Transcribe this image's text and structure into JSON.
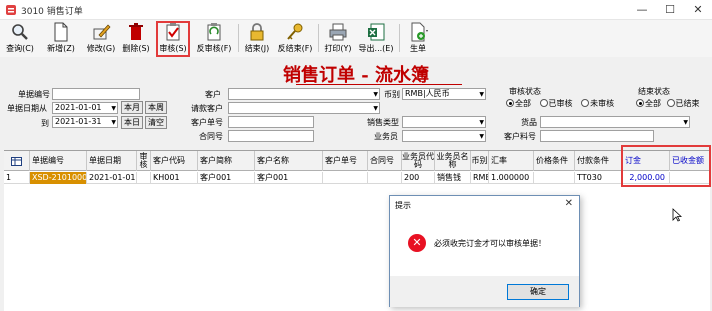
{
  "window": {
    "title": "3010 销售订单",
    "controls": [
      "—",
      "☐",
      "✕"
    ]
  },
  "toolbar": [
    {
      "label": "查询(C)",
      "icon": "search-icon"
    },
    {
      "label": "新增(Z)",
      "icon": "new-doc-icon"
    },
    {
      "label": "修改(G)",
      "icon": "edit-icon"
    },
    {
      "label": "删除(S)",
      "icon": "delete-icon"
    },
    {
      "label": "审核(S)",
      "icon": "approve-icon"
    },
    {
      "label": "反审核(F)",
      "icon": "unapprove-icon"
    },
    {
      "label": "结束(J)",
      "icon": "lock-icon"
    },
    {
      "label": "反结束(F)",
      "icon": "key-icon"
    },
    {
      "label": "打印(Y)",
      "icon": "print-icon"
    },
    {
      "label": "导出...(E)",
      "icon": "excel-export-icon"
    },
    {
      "label": "生单",
      "icon": "generate-icon"
    }
  ],
  "header": {
    "title": "销售订单 - 流水簿"
  },
  "filters": {
    "order_no_label": "单据编号",
    "date_from_label": "单据日期从",
    "date_from": "2021-01-01",
    "date_to_label": "到",
    "date_to": "2021-01-31",
    "this_month": "本月",
    "this_week": "本周",
    "today": "本日",
    "clear": "清空",
    "customer_label": "客户",
    "requester_label": "请款客户",
    "customer_no_label": "客户单号",
    "contract_label": "合同号",
    "currency_label": "币别",
    "currency_value": "RMB|人民币",
    "sales_type_label": "销售类型",
    "salesman_label": "业务员",
    "product_label": "货品",
    "customer_part_label": "客户料号",
    "audit_status_label": "审核状态",
    "audit_options": [
      "全部",
      "已审核",
      "未审核"
    ],
    "audit_selected": 0,
    "end_status_label": "结束状态",
    "end_options": [
      "全部",
      "已结束"
    ],
    "end_selected": 0
  },
  "grid": {
    "columns": [
      "单据编号",
      "单据日期",
      "审核",
      "客户代码",
      "客户简称",
      "客户名称",
      "客户单号",
      "合同号",
      "业务员代码",
      "业务员名称",
      "币别",
      "汇率",
      "价格条件",
      "付款条件",
      "订金",
      "已收金额"
    ],
    "rows": [
      {
        "index": "1",
        "cells": [
          "XSD-21010001",
          "2021-01-01",
          "",
          "KH001",
          "客户001",
          "客户001",
          "",
          "",
          "200",
          "销售钱",
          "RMB",
          "1.000000",
          "",
          "TT030",
          "2,000.00",
          ""
        ]
      }
    ]
  },
  "dialog": {
    "title": "提示",
    "message": "必须收完订金才可以审核单据！",
    "ok": "确定"
  },
  "colors": {
    "highlight": "#e23b3b",
    "title_red": "#c00000",
    "selected_cell": "#d89000",
    "amount_blue": "#0000c8"
  }
}
